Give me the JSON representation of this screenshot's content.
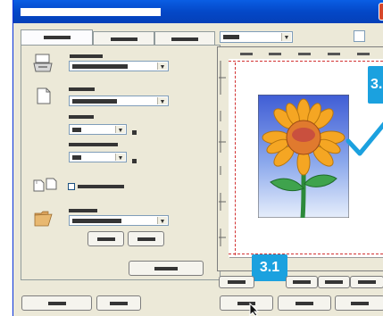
{
  "window": {
    "close_symbol": "✕"
  },
  "callouts": {
    "paper_size": "3.1",
    "output_side": "3."
  },
  "preview": {
    "image": "sunflower",
    "check": "checkmark"
  },
  "colors": {
    "title_bar": "#0449C8",
    "callout": "#1BA1DF",
    "check": "#1BA1DF",
    "margin_guide": "#D23232",
    "face": "#ECE9D8"
  },
  "icons": [
    "paper-source-icon",
    "paper-size-icon",
    "duplex-icon",
    "folder-icon",
    "preview-orientation-icon",
    "mouse-cursor-icon"
  ]
}
